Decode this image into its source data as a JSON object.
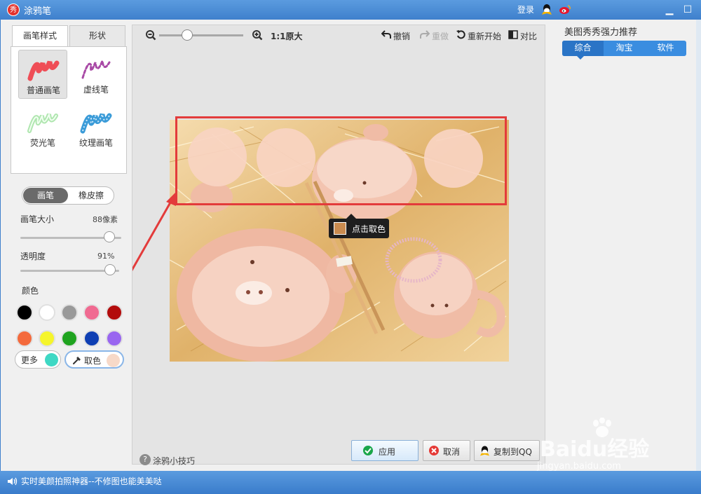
{
  "window": {
    "title": "涂鸦笔",
    "login": "登录",
    "logo_char": "秀"
  },
  "left_panel": {
    "tabs": [
      {
        "label": "画笔样式",
        "active": true
      },
      {
        "label": "形状",
        "active": false
      }
    ],
    "brushes": [
      {
        "label": "普通画笔",
        "selected": true
      },
      {
        "label": "虚线笔",
        "selected": false
      },
      {
        "label": "荧光笔",
        "selected": false
      },
      {
        "label": "纹理画笔",
        "selected": false
      }
    ],
    "mode": {
      "pen": "画笔",
      "eraser": "橡皮擦",
      "active": "pen"
    },
    "brush_size": {
      "label": "画笔大小",
      "value": "88像素",
      "fraction": 0.88
    },
    "opacity": {
      "label": "透明度",
      "value": "91%",
      "fraction": 0.91
    },
    "colors_label": "颜色",
    "colors": [
      "#000000",
      "#ffffff",
      "#999999",
      "#f06a91",
      "#b30c0c",
      "#f46a3c",
      "#f5f52b",
      "#1fa31f",
      "#0f3fb3",
      "#9966f0"
    ],
    "more": {
      "label": "更多",
      "color": "#3ed8c4"
    },
    "picker": {
      "label": "取色",
      "color": "#f7d9c8"
    }
  },
  "toolbar": {
    "zoom_fraction": 0.33,
    "actual_size": "1:1原大",
    "undo": "撤销",
    "redo": "重做",
    "restart": "重新开始",
    "compare": "对比"
  },
  "canvas": {
    "pick_tooltip": "点击取色",
    "picked_color": "#c98b4f",
    "tips": "涂鸦小技巧"
  },
  "buttons": {
    "apply": "应用",
    "cancel": "取消",
    "copy_qq": "复制到QQ"
  },
  "right_panel": {
    "title": "美图秀秀强力推荐",
    "tabs": [
      "综合",
      "淘宝",
      "软件"
    ]
  },
  "statusbar": {
    "text": "实时美颜拍照神器--不修图也能美美哒"
  },
  "watermark": {
    "brand": "Baidu经验",
    "url": "jingyan.baidu.com"
  }
}
